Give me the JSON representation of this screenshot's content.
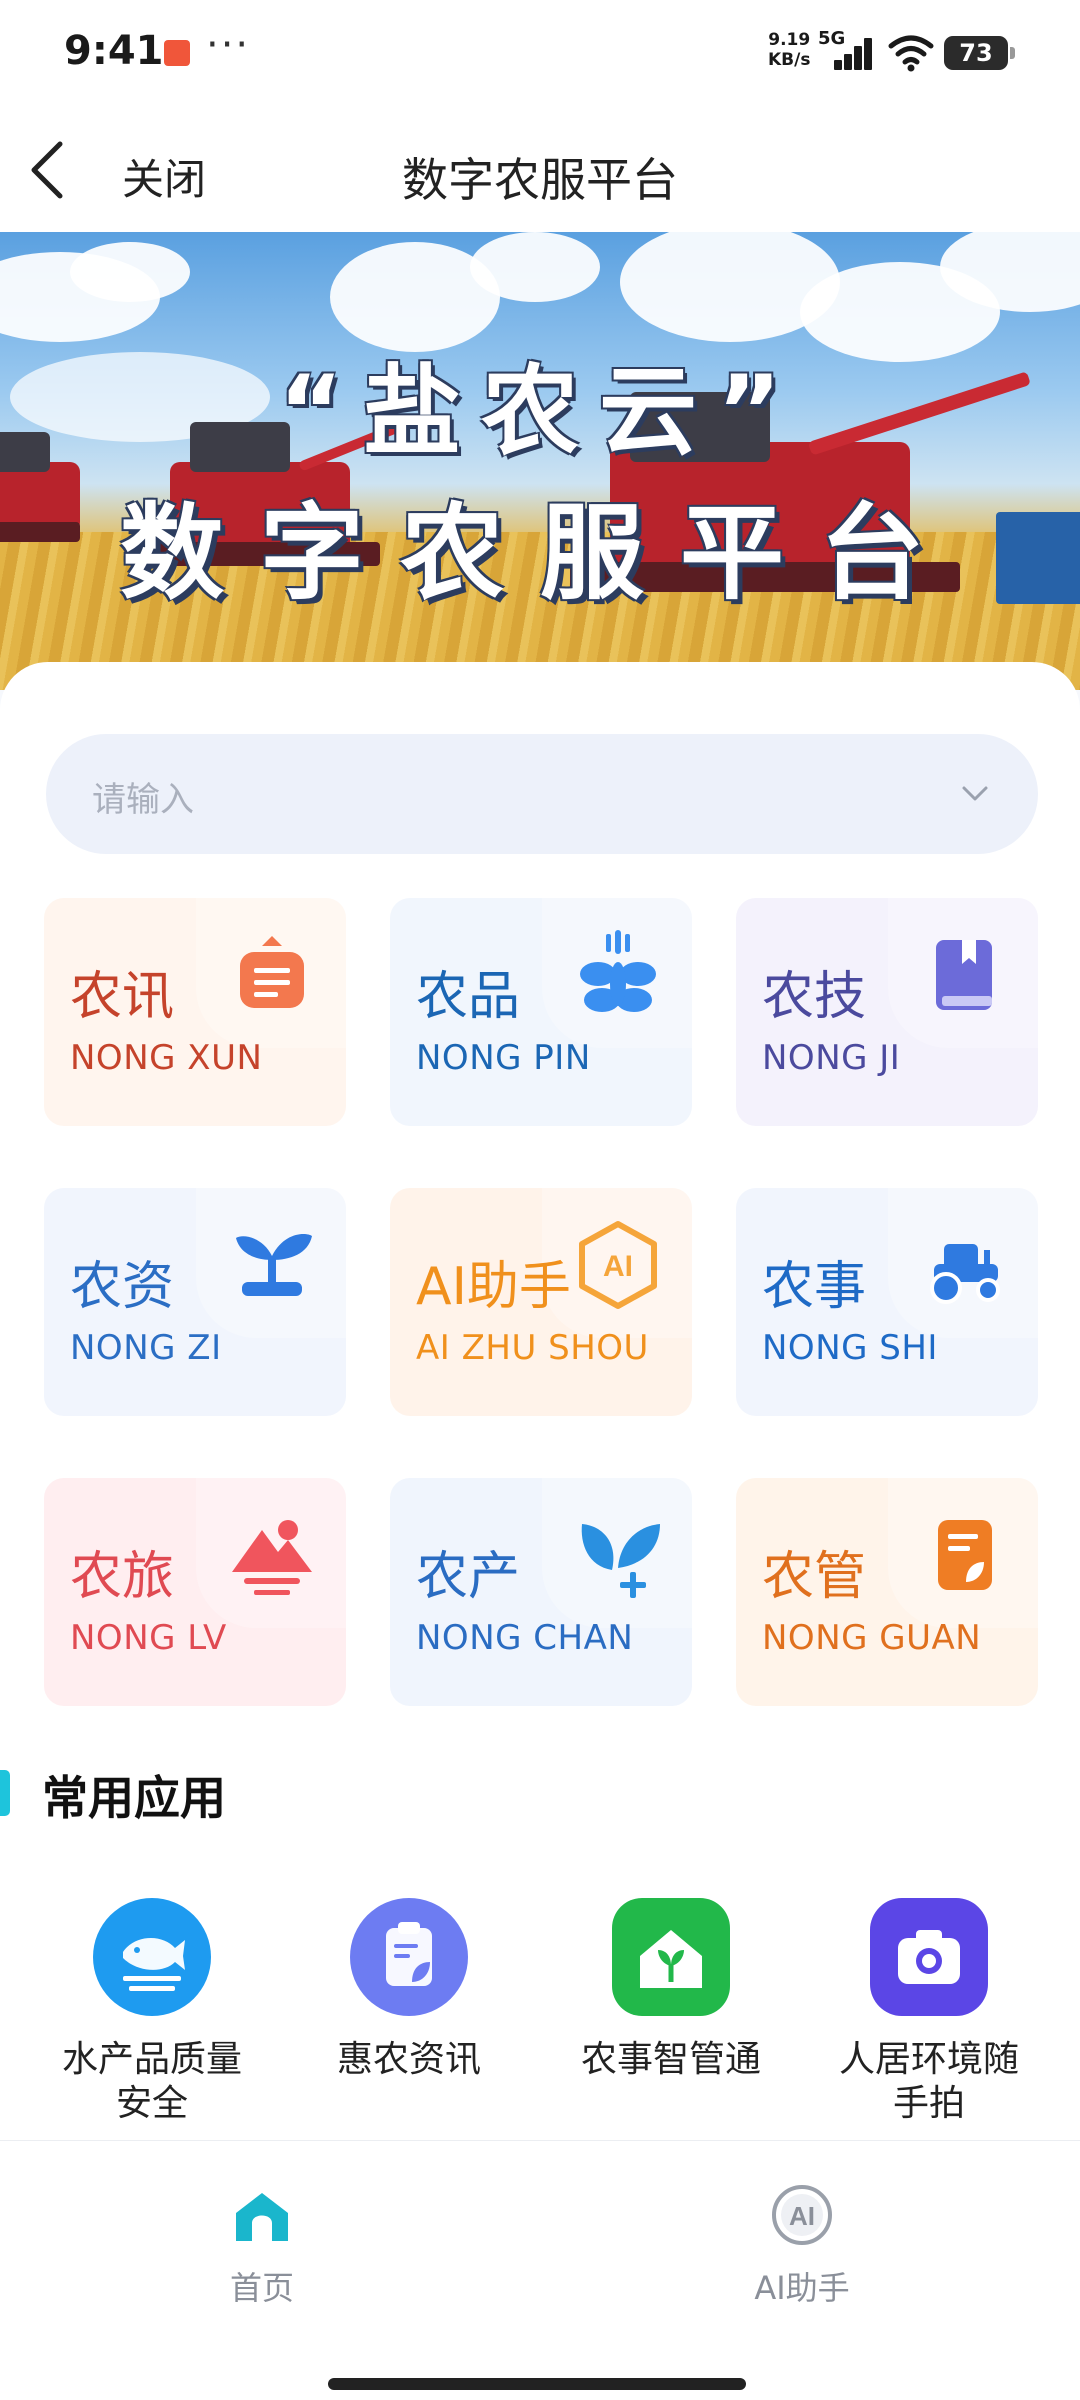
{
  "status_bar": {
    "time": "9:41",
    "more": "···",
    "net_speed_value": "9.19",
    "net_speed_unit": "KB/s",
    "network": "5G",
    "battery": "73"
  },
  "nav": {
    "close_label": "关闭",
    "title": "数字农服平台"
  },
  "banner": {
    "line1": "“盐农云”",
    "line2": "数字农服平台"
  },
  "search": {
    "placeholder": "请输入"
  },
  "tiles": [
    {
      "cn": "农讯",
      "en": "NONG XUN",
      "bg": "#fff5ee",
      "color": "#c5432b",
      "icon": "newspaper-icon",
      "accent": "#f3784e"
    },
    {
      "cn": "农品",
      "en": "NONG PIN",
      "bg": "#f1f6fd",
      "color": "#1b66b4",
      "icon": "wheat-icon",
      "accent": "#3a8ff0"
    },
    {
      "cn": "农技",
      "en": "NONG JI",
      "bg": "#f4f2fc",
      "color": "#4b4a9e",
      "icon": "book-icon",
      "accent": "#6c6bd9"
    },
    {
      "cn": "农资",
      "en": "NONG ZI",
      "bg": "#f1f5fd",
      "color": "#2b6ec4",
      "icon": "sprout-icon",
      "accent": "#2f7ae0"
    },
    {
      "cn": "AI助手",
      "en": "AI ZHU SHOU",
      "bg": "#fff3ea",
      "color": "#f0901c",
      "icon": "ai-hexagon-icon",
      "accent": "#f5a53a"
    },
    {
      "cn": "农事",
      "en": "NONG SHI",
      "bg": "#f1f5fd",
      "color": "#1e6ac6",
      "icon": "tractor-icon",
      "accent": "#2f7ae0"
    },
    {
      "cn": "农旅",
      "en": "NONG LV",
      "bg": "#ffeef0",
      "color": "#e04a52",
      "icon": "mountain-sun-icon",
      "accent": "#f0555d"
    },
    {
      "cn": "农产",
      "en": "NONG CHAN",
      "bg": "#f0f5fd",
      "color": "#2a6cc2",
      "icon": "leaf-plus-icon",
      "accent": "#2a90e0"
    },
    {
      "cn": "农管",
      "en": "NONG GUAN",
      "bg": "#fff4ea",
      "color": "#e0701e",
      "icon": "document-leaf-icon",
      "accent": "#ef7d24"
    }
  ],
  "section": {
    "title": "常用应用"
  },
  "apps": [
    {
      "label_1": "水产品质量",
      "label_2": "安全",
      "icon": "fish-icon",
      "color": "#1e9bf0"
    },
    {
      "label_1": "惠农资讯",
      "label_2": "",
      "icon": "clipboard-leaf-icon",
      "color": "#6d7cf2"
    },
    {
      "label_1": "农事智管通",
      "label_2": "",
      "icon": "house-sprout-icon",
      "color": "#22b84a"
    },
    {
      "label_1": "人居环境随",
      "label_2": "手拍",
      "icon": "camera-icon",
      "color": "#5b46e6"
    }
  ],
  "tabbar": {
    "home_label": "首页",
    "ai_label": "AI助手",
    "active_color": "#1ab6cc",
    "inactive_color": "#8a8f99"
  }
}
